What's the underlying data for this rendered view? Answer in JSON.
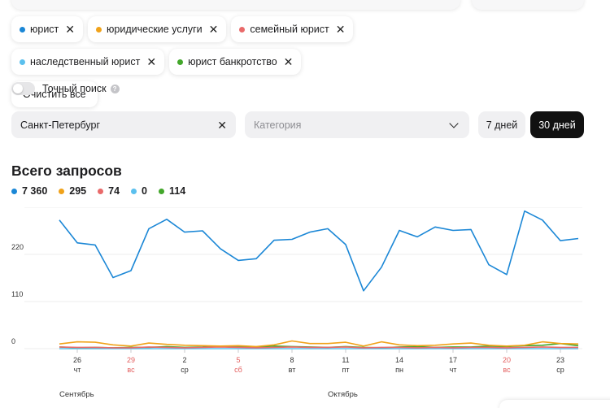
{
  "chips": [
    {
      "label": "юрист",
      "color": "#1b87d6"
    },
    {
      "label": "юридические услуги",
      "color": "#f0a21a"
    },
    {
      "label": "семейный юрист",
      "color": "#e96a6a"
    },
    {
      "label": "наследственный юрист",
      "color": "#5bc0ee"
    },
    {
      "label": "юрист банкротство",
      "color": "#43a72b"
    }
  ],
  "clear_all_label": "Очистить все",
  "exact_search_label": "Точный поиск",
  "help_glyph": "?",
  "city_value": "Санкт-Петербург",
  "category_placeholder": "Категория",
  "period_7_label": "7 дней",
  "period_30_label": "30 дней",
  "chart_title": "Всего запросов",
  "legend": [
    {
      "value": "7 360",
      "color": "#1b87d6"
    },
    {
      "value": "295",
      "color": "#f0a21a"
    },
    {
      "value": "74",
      "color": "#e96a6a"
    },
    {
      "value": "0",
      "color": "#5bc0ee"
    },
    {
      "value": "114",
      "color": "#43a72b"
    }
  ],
  "months": [
    {
      "label": "Сентябрь",
      "at": 1
    },
    {
      "label": "Октябрь",
      "at": 16
    }
  ],
  "chart_data": {
    "type": "line",
    "title": "Всего запросов",
    "ylim": [
      0,
      330
    ],
    "yticks": [
      0,
      110,
      220,
      330
    ],
    "grid": true,
    "x_ticks": [
      {
        "i": 1,
        "day": "26",
        "weekday": "чт",
        "weekend": false
      },
      {
        "i": 4,
        "day": "29",
        "weekday": "вс",
        "weekend": true
      },
      {
        "i": 7,
        "day": "2",
        "weekday": "ср",
        "weekend": false
      },
      {
        "i": 10,
        "day": "5",
        "weekday": "сб",
        "weekend": true
      },
      {
        "i": 13,
        "day": "8",
        "weekday": "вт",
        "weekend": false
      },
      {
        "i": 16,
        "day": "11",
        "weekday": "пт",
        "weekend": false
      },
      {
        "i": 19,
        "day": "14",
        "weekday": "пн",
        "weekend": false
      },
      {
        "i": 22,
        "day": "17",
        "weekday": "чт",
        "weekend": false
      },
      {
        "i": 25,
        "day": "20",
        "weekday": "вс",
        "weekend": true
      },
      {
        "i": 28,
        "day": "23",
        "weekday": "ср",
        "weekend": false
      }
    ],
    "series": [
      {
        "color": "#1b87d6",
        "values": [
          300,
          247,
          242,
          166,
          182,
          280,
          302,
          272,
          275,
          233,
          206,
          210,
          253,
          255,
          272,
          280,
          243,
          135,
          190,
          276,
          261,
          284,
          276,
          278,
          196,
          173,
          321,
          300,
          252,
          257
        ]
      },
      {
        "color": "#f0a21a",
        "values": [
          11,
          16,
          15,
          9,
          6,
          13,
          10,
          8,
          7,
          6,
          7,
          5,
          9,
          18,
          12,
          12,
          15,
          6,
          16,
          9,
          7,
          8,
          11,
          13,
          8,
          6,
          8,
          16,
          12,
          11
        ]
      },
      {
        "color": "#e96a6a",
        "values": [
          4,
          3,
          3,
          2,
          2,
          4,
          3,
          2,
          3,
          4,
          3,
          2,
          3,
          4,
          3,
          3,
          4,
          2,
          3,
          3,
          2,
          3,
          2,
          3,
          3,
          2,
          3,
          4,
          3,
          3
        ]
      },
      {
        "color": "#5bc0ee",
        "values": [
          0,
          0,
          0,
          0,
          0,
          0,
          0,
          0,
          0,
          0,
          0,
          0,
          0,
          0,
          0,
          0,
          0,
          0,
          0,
          0,
          0,
          0,
          0,
          0,
          0,
          0,
          0,
          0,
          0,
          0
        ]
      },
      {
        "color": "#43a72b",
        "values": [
          4,
          2,
          3,
          2,
          3,
          3,
          5,
          3,
          4,
          6,
          5,
          4,
          6,
          5,
          4,
          3,
          5,
          3,
          2,
          4,
          5,
          3,
          4,
          4,
          6,
          5,
          7,
          8,
          12,
          7
        ]
      }
    ]
  }
}
